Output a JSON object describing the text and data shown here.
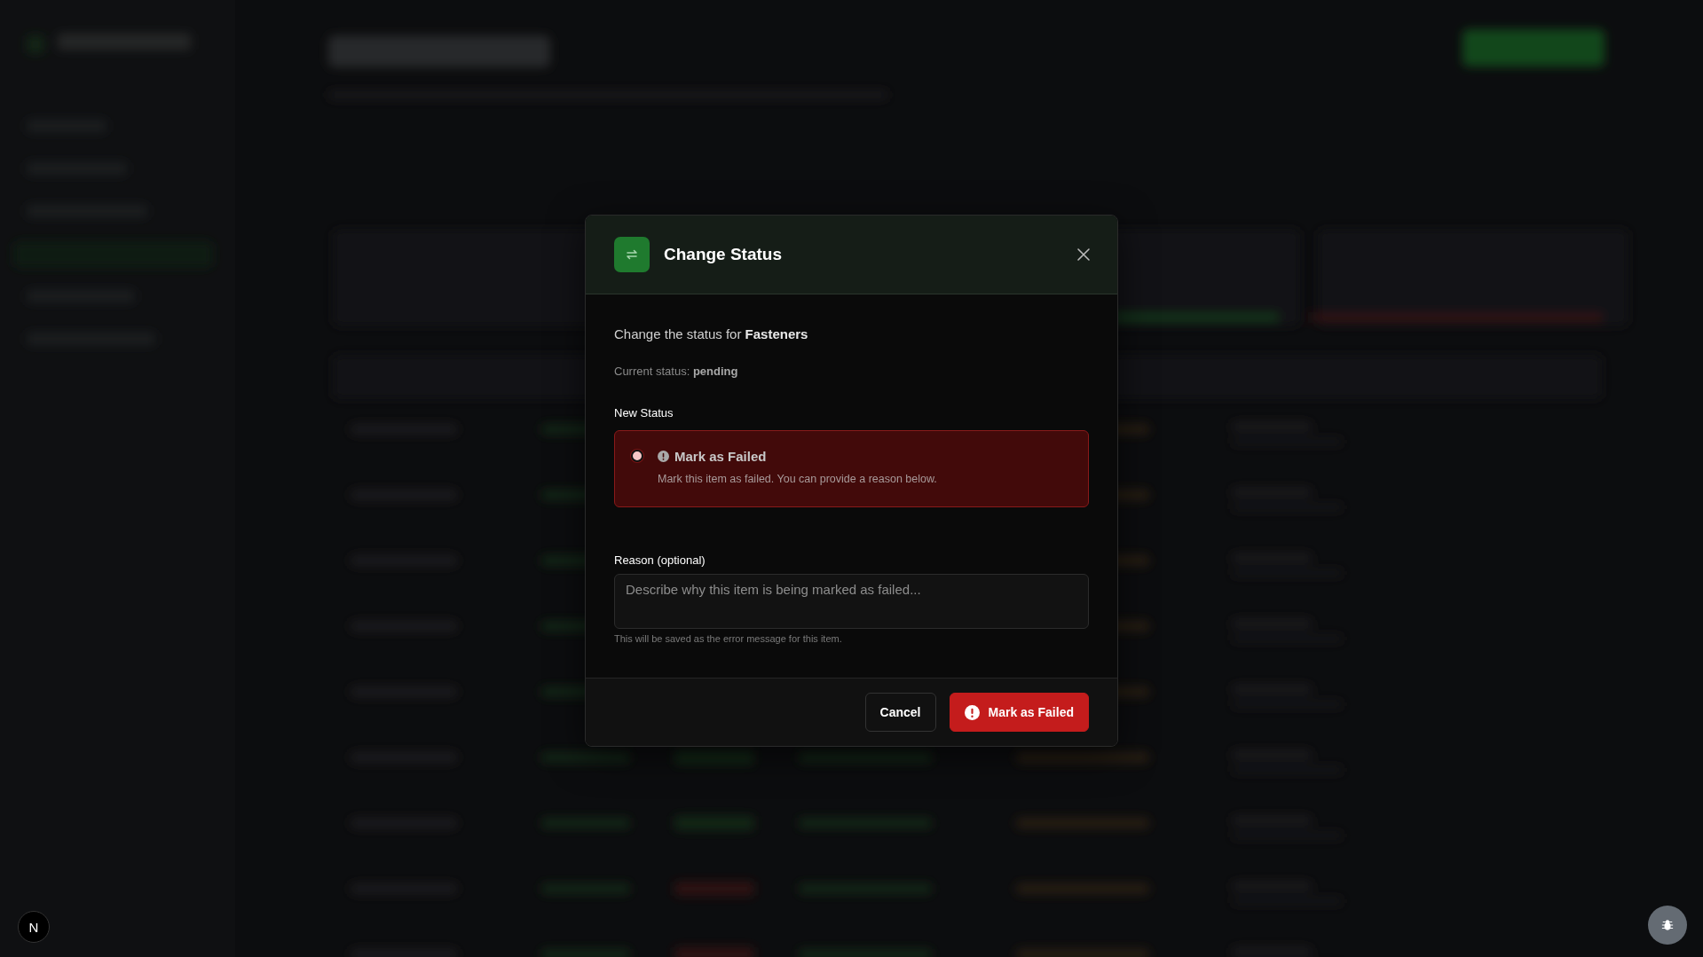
{
  "dialog": {
    "title": "Change Status",
    "intro": "Change the status for **Fasteners**",
    "current_status": "Current status: **pending**",
    "new_status_label": "New Status",
    "options": [
      {
        "kind": "failed",
        "label": "Mark as Failed",
        "description": "Mark this item as failed. You can provide a reason below.",
        "selected": true
      }
    ],
    "reason": {
      "label": "Reason (optional)",
      "placeholder": "Describe why this item is being marked as failed...",
      "hint": "This will be saved as the error message for this item."
    },
    "buttons": [
      {
        "kind": "secondary",
        "label": "Cancel"
      },
      {
        "kind": "danger",
        "label": "Mark as Failed"
      }
    ]
  },
  "corner_badge": {
    "label": "N"
  }
}
